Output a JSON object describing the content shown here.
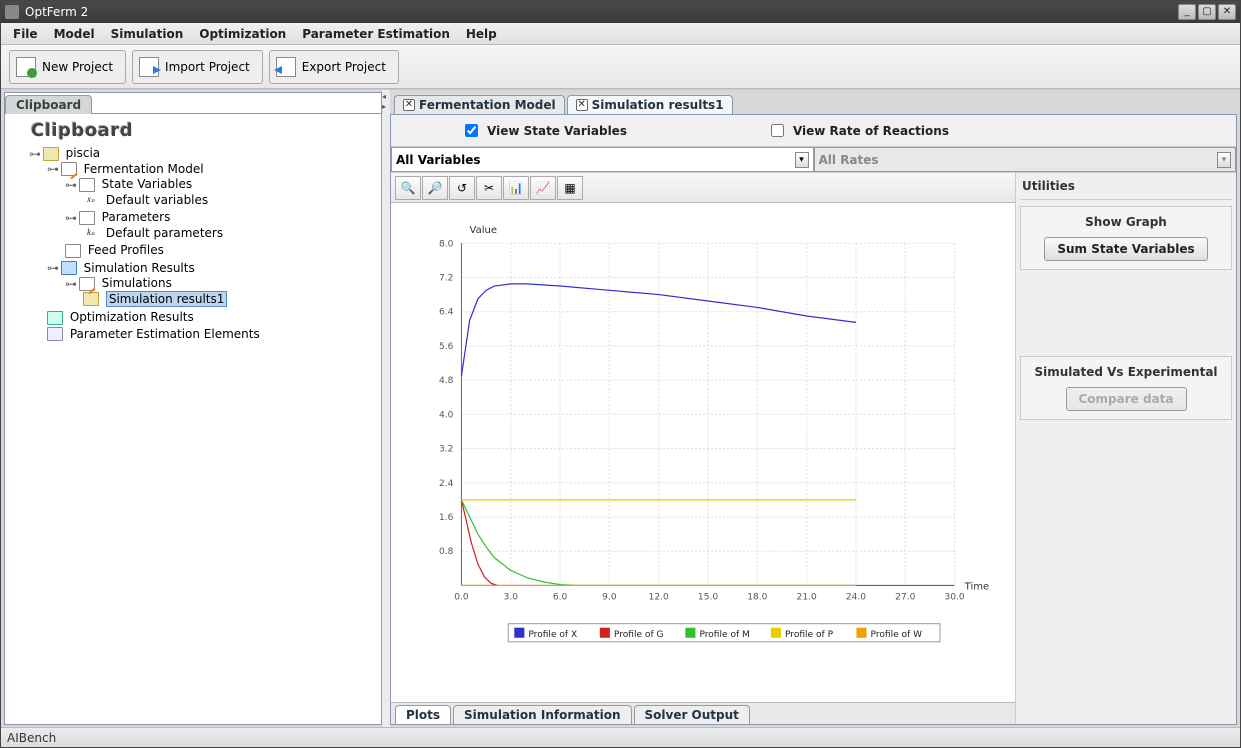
{
  "window": {
    "title": "OptFerm 2",
    "min": "_",
    "max": "▢",
    "close": "✕"
  },
  "menu": [
    "File",
    "Model",
    "Simulation",
    "Optimization",
    "Parameter Estimation",
    "Help"
  ],
  "toolbar": {
    "new": "New Project",
    "import": "Import Project",
    "export": "Export Project"
  },
  "clipboard": {
    "tab": "Clipboard",
    "heading": "Clipboard",
    "tree": {
      "project": "piscia",
      "model": "Fermentation Model",
      "state_vars": "State Variables",
      "default_vars": "Default variables",
      "parameters": "Parameters",
      "default_params": "Default parameters",
      "feed_profiles": "Feed Profiles",
      "sim_results": "Simulation Results",
      "simulations": "Simulations",
      "sim_results1": "Simulation results1",
      "opt_results": "Optimization Results",
      "par_est": "Parameter Estimation Elements"
    }
  },
  "tabs": {
    "t1": "Fermentation Model",
    "t2": "Simulation results1"
  },
  "view": {
    "state_vars_label": "View State Variables",
    "state_vars_checked": true,
    "rates_label": "View Rate of Reactions",
    "rates_checked": false
  },
  "combos": {
    "vars": "All Variables",
    "rates": "All Rates"
  },
  "bottom_tabs": [
    "Plots",
    "Simulation Information",
    "Solver Output"
  ],
  "utilities": {
    "title": "Utilities",
    "group1_title": "Show Graph",
    "sum_btn": "Sum State Variables",
    "group2_title": "Simulated Vs Experimental",
    "compare_btn": "Compare data"
  },
  "status": "AIBench",
  "chart_data": {
    "type": "line",
    "title": "",
    "xlabel": "Time",
    "ylabel": "Value",
    "xlim": [
      0,
      30
    ],
    "ylim": [
      0,
      8
    ],
    "x_ticks": [
      0.0,
      3.0,
      6.0,
      9.0,
      12.0,
      15.0,
      18.0,
      21.0,
      24.0,
      27.0,
      30.0
    ],
    "y_ticks": [
      0.8,
      1.6,
      2.4,
      3.2,
      4.0,
      4.8,
      5.6,
      6.4,
      7.2,
      8.0
    ],
    "series": [
      {
        "name": "Profile of X",
        "color": "#3030d0",
        "x": [
          0,
          0.5,
          1,
          1.5,
          2,
          3,
          4,
          6,
          9,
          12,
          15,
          18,
          21,
          24
        ],
        "y": [
          4.9,
          6.2,
          6.7,
          6.9,
          7.0,
          7.05,
          7.05,
          7.0,
          6.9,
          6.8,
          6.65,
          6.5,
          6.3,
          6.15
        ]
      },
      {
        "name": "Profile of G",
        "color": "#d02020",
        "x": [
          0,
          0.3,
          0.6,
          1.0,
          1.4,
          1.8,
          2.2
        ],
        "y": [
          2.0,
          1.5,
          1.0,
          0.5,
          0.2,
          0.05,
          0.0
        ]
      },
      {
        "name": "Profile of M",
        "color": "#30c030",
        "x": [
          0,
          0.5,
          1,
          1.5,
          2,
          3,
          4,
          5,
          6,
          7,
          24
        ],
        "y": [
          2.0,
          1.6,
          1.2,
          0.9,
          0.65,
          0.35,
          0.18,
          0.08,
          0.02,
          0.0,
          0.0
        ]
      },
      {
        "name": "Profile of P",
        "color": "#e8d000",
        "x": [
          0,
          24
        ],
        "y": [
          2.0,
          2.0
        ]
      },
      {
        "name": "Profile of W",
        "color": "#f0a000",
        "x": [
          0,
          24
        ],
        "y": [
          0.0,
          0.0
        ]
      }
    ],
    "legend": [
      "Profile of X",
      "Profile of G",
      "Profile of M",
      "Profile of P",
      "Profile of W"
    ],
    "legend_colors": [
      "#3030d0",
      "#d02020",
      "#30c030",
      "#e8d000",
      "#f0a000"
    ]
  }
}
